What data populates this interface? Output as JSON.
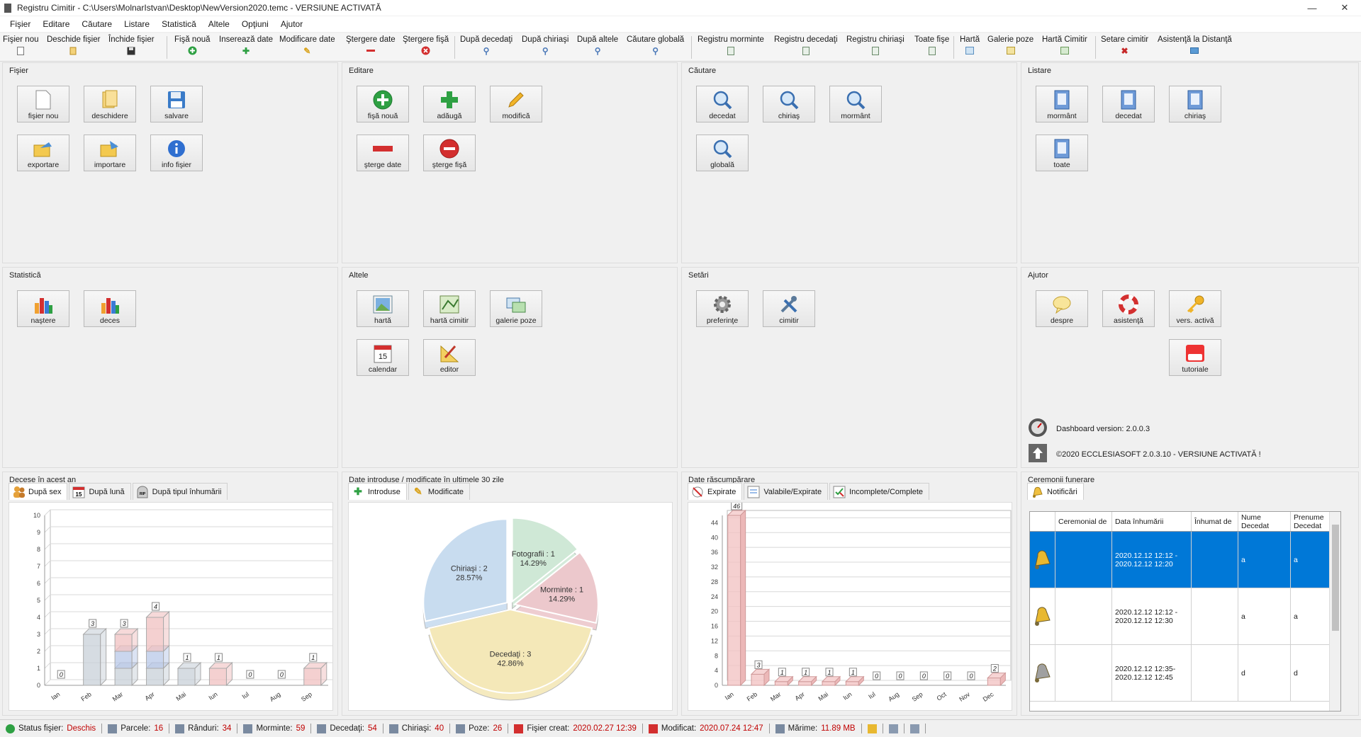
{
  "window": {
    "title": "Registru Cimitir  -  C:\\Users\\MolnarIstvan\\Desktop\\NewVersion2020.temc  -  VERSIUNE ACTIVATĂ",
    "controls": {
      "minimize": "—",
      "close": "✕"
    }
  },
  "menu": [
    "Fişier",
    "Editare",
    "Căutare",
    "Listare",
    "Statistică",
    "Altele",
    "Opţiuni",
    "Ajutor"
  ],
  "toolbar": [
    {
      "label": "Fişier nou",
      "icon": "new-file-icon"
    },
    {
      "label": "Deschide fişier",
      "icon": "open-folder-icon"
    },
    {
      "label": "Închide fişier",
      "icon": "save-disk-icon"
    },
    {
      "label": "Fişă nouă",
      "icon": "add-circle-icon"
    },
    {
      "label": "Inserează date",
      "icon": "plus-icon"
    },
    {
      "label": "Modificare date",
      "icon": "pencil-icon"
    },
    {
      "label": "Ştergere date",
      "icon": "minus-icon"
    },
    {
      "label": "Ştergere fişă",
      "icon": "delete-circle-icon"
    },
    {
      "label": "După decedaţi",
      "icon": "search-icon"
    },
    {
      "label": "După chiriaşi",
      "icon": "search-icon"
    },
    {
      "label": "După altele",
      "icon": "search-icon"
    },
    {
      "label": "Căutare globală",
      "icon": "search-icon"
    },
    {
      "label": "Registru morminte",
      "icon": "register-icon"
    },
    {
      "label": "Registru decedaţi",
      "icon": "register-icon"
    },
    {
      "label": "Registru chiriaşi",
      "icon": "register-icon"
    },
    {
      "label": "Toate fişe",
      "icon": "register-icon"
    },
    {
      "label": "Hartă",
      "icon": "map-icon"
    },
    {
      "label": "Galerie poze",
      "icon": "gallery-icon"
    },
    {
      "label": "Hartă Cimitir",
      "icon": "cemetery-map-icon"
    },
    {
      "label": "Setare cimitir",
      "icon": "tools-icon"
    },
    {
      "label": "Asistenţă la Distanţă",
      "icon": "remote-icon"
    }
  ],
  "panels": {
    "fisier": {
      "title": "Fişier",
      "tiles": [
        "fişier nou",
        "deschidere",
        "salvare",
        "exportare",
        "importare",
        "info fişier"
      ]
    },
    "editare": {
      "title": "Editare",
      "tiles": [
        "fişă nouă",
        "adăugă",
        "modifică",
        "şterge date",
        "şterge fişă"
      ]
    },
    "cautare": {
      "title": "Căutare",
      "tiles": [
        "decedat",
        "chiriaş",
        "mormânt",
        "globală"
      ]
    },
    "listare": {
      "title": "Listare",
      "tiles": [
        "mormânt",
        "decedat",
        "chiriaş",
        "toate"
      ]
    },
    "statistica": {
      "title": "Statistică",
      "tiles": [
        "naştere",
        "deces"
      ]
    },
    "altele": {
      "title": "Altele",
      "tiles": [
        "hartă",
        "hartă cimitir",
        "galerie poze",
        "calendar",
        "editor"
      ]
    },
    "setari": {
      "title": "Setări",
      "tiles": [
        "preferinţe",
        "cimitir"
      ]
    },
    "ajutor": {
      "title": "Ajutor",
      "tiles": [
        "despre",
        "asistenţă",
        "vers. activă",
        "tutoriale"
      ],
      "dashboard_version": "Dashboard version: 2.0.0.3",
      "copyright": "©2020 ECCLESIASOFT 2.0.3.10 - VERSIUNE ACTIVATĂ !"
    }
  },
  "deces_panel": {
    "title": "Decese în acest an",
    "tabs": [
      "După sex",
      "După lună",
      "După tipul înhumării"
    ],
    "tab_icon_texts": [
      "15",
      "RIP"
    ]
  },
  "date_panel": {
    "title": "Date introduse / modificate în ultimele 30 zile",
    "tabs": [
      "Introduse",
      "Modificate"
    ]
  },
  "rascumparare_panel": {
    "title": "Date răscumpărare",
    "tabs": [
      "Expirate",
      "Valabile/Expirate",
      "Incomplete/Complete"
    ]
  },
  "ceremonii_panel": {
    "title": "Ceremonii funerare",
    "tabs": [
      "Notificări"
    ],
    "columns": [
      "Ceremonial de",
      "Data înhumării",
      "Înhumat de",
      "Nume Decedat",
      "Prenume Decedat"
    ],
    "rows": [
      {
        "ceremonial": "",
        "data": "2020.12.12 12:12 - 2020.12.12 12:20",
        "inhumat": "",
        "nume": "a",
        "prenume": "a",
        "selected": true
      },
      {
        "ceremonial": "",
        "data": "2020.12.12 12:12 - 2020.12.12 12:30",
        "inhumat": "",
        "nume": "a",
        "prenume": "a",
        "selected": false
      },
      {
        "ceremonial": "",
        "data": "2020.12.12 12:35-2020.12.12 12:45",
        "inhumat": "",
        "nume": "d",
        "prenume": "d",
        "selected": false
      }
    ]
  },
  "status": [
    {
      "label": "Status fişier:",
      "value": "Deschis"
    },
    {
      "label": "Parcele:",
      "value": "16"
    },
    {
      "label": "Rânduri:",
      "value": "34"
    },
    {
      "label": "Morminte:",
      "value": "59"
    },
    {
      "label": "Decedaţi:",
      "value": "54"
    },
    {
      "label": "Chiriaşi:",
      "value": "40"
    },
    {
      "label": "Poze:",
      "value": "26"
    },
    {
      "label": "Fişier creat:",
      "value": "2020.02.27 12:39"
    },
    {
      "label": "Modificat:",
      "value": "2020.07.24 12:47"
    },
    {
      "label": "Mărime:",
      "value": "11.89 MB"
    }
  ],
  "chart_data": [
    {
      "type": "bar",
      "categories": [
        "Ian",
        "Feb",
        "Mar",
        "Apr",
        "Mai",
        "Iun",
        "Iul",
        "Aug",
        "Sep"
      ],
      "values": [
        0,
        3,
        3,
        4,
        1,
        1,
        0,
        0,
        1
      ],
      "series": [
        {
          "name": "",
          "values": [
            0,
            3,
            1,
            1,
            1,
            0,
            0,
            0,
            0
          ],
          "color": "#c8d0d8"
        },
        {
          "name": "",
          "values": [
            0,
            0,
            1,
            1,
            0,
            0,
            0,
            0,
            0
          ],
          "color": "#b8c8e8"
        },
        {
          "name": "",
          "values": [
            0,
            0,
            1,
            2,
            0,
            1,
            0,
            0,
            1
          ],
          "color": "#f0c0c0"
        }
      ],
      "ylim": [
        0,
        10
      ],
      "yticks": [
        0,
        1,
        2,
        3,
        4,
        5,
        6,
        7,
        8,
        9,
        10
      ]
    },
    {
      "type": "pie",
      "slices": [
        {
          "label": "Chiriaşi : 2",
          "pct": "28.57%",
          "value": 2,
          "color": "#c8dcef"
        },
        {
          "label": "Fotografii : 1",
          "pct": "14.29%",
          "value": 1,
          "color": "#cfe8d6"
        },
        {
          "label": "Morminte : 1",
          "pct": "14.29%",
          "value": 1,
          "color": "#ecc8cc"
        },
        {
          "label": "Decedaţi : 3",
          "pct": "42.86%",
          "value": 3,
          "color": "#f4e8b8"
        }
      ]
    },
    {
      "type": "bar",
      "categories": [
        "Ian",
        "Feb",
        "Mar",
        "Apr",
        "Mai",
        "Iun",
        "Iul",
        "Aug",
        "Sep",
        "Oct",
        "Nov",
        "Dec"
      ],
      "values": [
        46,
        3,
        1,
        1,
        1,
        1,
        0,
        0,
        0,
        0,
        0,
        2
      ],
      "ylim": [
        0,
        46
      ],
      "yticks": [
        0,
        4,
        8,
        12,
        16,
        20,
        24,
        28,
        32,
        36,
        40,
        44
      ]
    }
  ]
}
